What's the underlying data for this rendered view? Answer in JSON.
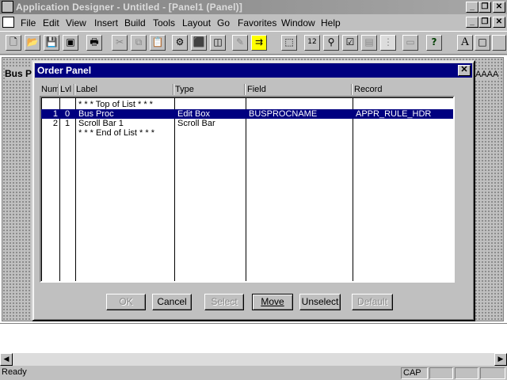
{
  "window": {
    "title": "Application Designer - Untitled - [Panel1 (Panel)]",
    "min_glyph": "_",
    "restore_glyph": "❐",
    "close_glyph": "✕"
  },
  "menubar": {
    "items": [
      {
        "label": "File"
      },
      {
        "label": "Edit"
      },
      {
        "label": "View"
      },
      {
        "label": "Insert"
      },
      {
        "label": "Build"
      },
      {
        "label": "Tools"
      },
      {
        "label": "Layout"
      },
      {
        "label": "Go"
      },
      {
        "label": "Favorites"
      },
      {
        "label": "Window"
      },
      {
        "label": "Help"
      }
    ]
  },
  "toolbar": {
    "icons": [
      {
        "name": "new-icon",
        "glyph": "🗋"
      },
      {
        "name": "open-icon",
        "glyph": "📂"
      },
      {
        "name": "save-icon",
        "glyph": "💾"
      },
      {
        "name": "save-all-icon",
        "glyph": "▣"
      },
      {
        "name": "print-icon",
        "glyph": "🖶"
      },
      {
        "name": "cut-icon",
        "glyph": "✂"
      },
      {
        "name": "copy-icon",
        "glyph": "⧉"
      },
      {
        "name": "paste-icon",
        "glyph": "📋"
      },
      {
        "name": "properties-icon",
        "glyph": "⚙"
      },
      {
        "name": "component-icon",
        "glyph": "⬛"
      },
      {
        "name": "project-icon",
        "glyph": "◫"
      },
      {
        "name": "edit-icon",
        "glyph": "✎"
      },
      {
        "name": "insert-field-icon",
        "glyph": "⇉"
      },
      {
        "name": "select-icon",
        "glyph": "⬚"
      },
      {
        "name": "order-icon",
        "glyph": "12"
      },
      {
        "name": "test-icon",
        "glyph": "⚲"
      },
      {
        "name": "validate-icon",
        "glyph": "☑"
      },
      {
        "name": "view-icon",
        "glyph": "▤"
      },
      {
        "name": "grid-icon",
        "glyph": "⋮"
      },
      {
        "name": "field-icon",
        "glyph": "▭"
      },
      {
        "name": "help-icon",
        "glyph": "?"
      },
      {
        "name": "text-icon",
        "glyph": "A"
      },
      {
        "name": "frame-icon",
        "glyph": "□"
      }
    ]
  },
  "workspace": {
    "bus_label": "Bus P",
    "aaaa_label": "AAAA"
  },
  "dialog": {
    "title": "Order Panel",
    "close_glyph": "✕",
    "columns": [
      "Num",
      "Lvl",
      "Label",
      "Type",
      "Field",
      "Record"
    ],
    "rows": [
      {
        "num": "",
        "lvl": "",
        "label": "* * * Top of List * * *",
        "type": "",
        "field": "",
        "record": "",
        "selected": false
      },
      {
        "num": "1",
        "lvl": "0",
        "label": "Bus Proc",
        "type": "Edit Box",
        "field": "BUSPROCNAME",
        "record": "APPR_RULE_HDR",
        "selected": true
      },
      {
        "num": "2",
        "lvl": "1",
        "label": "Scroll Bar 1",
        "type": "Scroll Bar",
        "field": "",
        "record": "",
        "selected": false
      },
      {
        "num": "",
        "lvl": "",
        "label": "* * * End of List * * *",
        "type": "",
        "field": "",
        "record": "",
        "selected": false
      }
    ],
    "buttons": {
      "ok": "OK",
      "cancel": "Cancel",
      "select": "Select",
      "move": "Move",
      "unselect": "Unselect",
      "default": "Default"
    }
  },
  "statusbar": {
    "text": "Ready",
    "cap": "CAP"
  },
  "scroll": {
    "left_glyph": "◀",
    "right_glyph": "▶"
  }
}
